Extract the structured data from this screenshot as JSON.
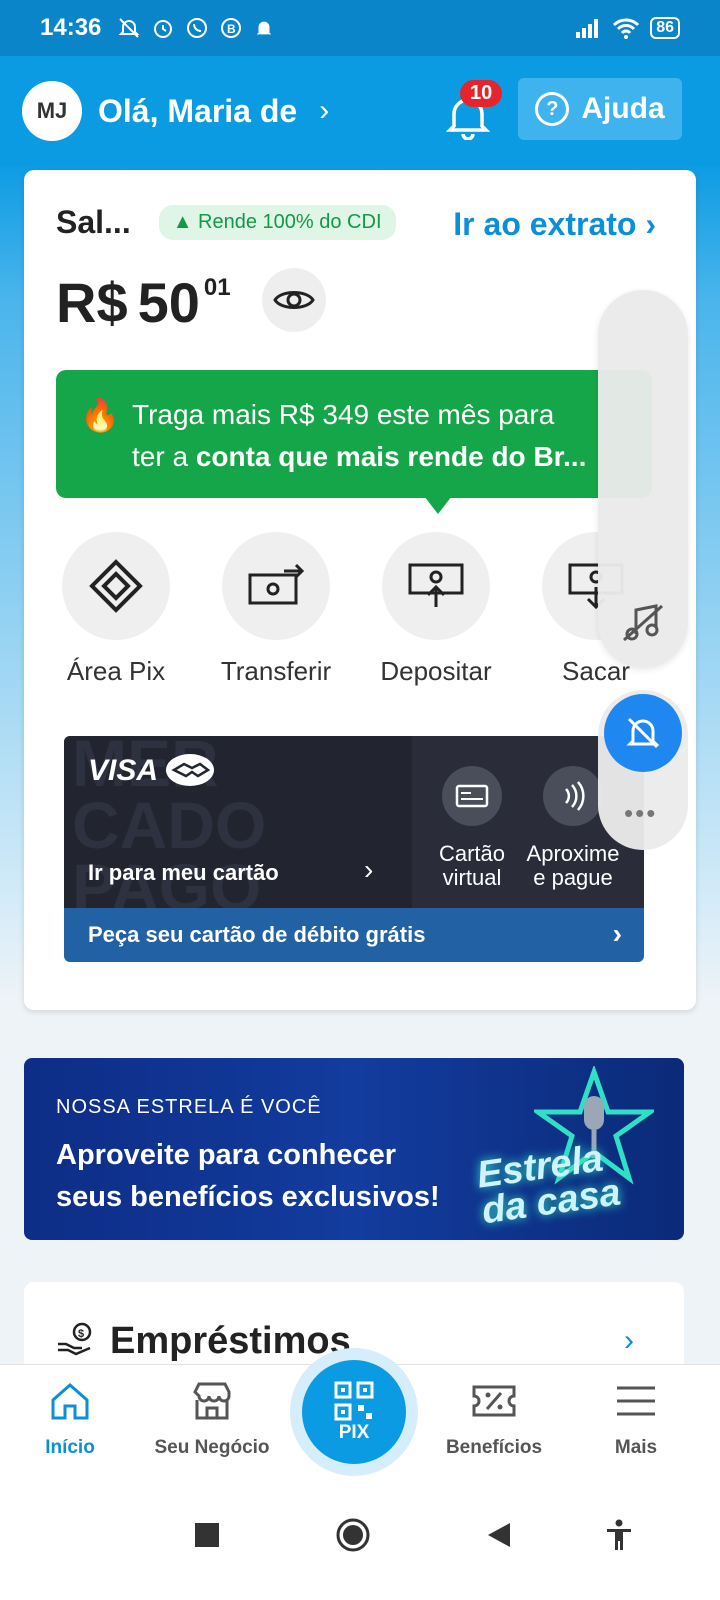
{
  "status_bar": {
    "time": "14:36",
    "battery": "86"
  },
  "header": {
    "avatar_initials": "MJ",
    "greeting": "Olá, Maria de",
    "notifications_count": "10",
    "help_label": "Ajuda"
  },
  "balance": {
    "label": "Sal...",
    "cdi_badge": "▲ Rende 100% do CDI",
    "statement_link": "Ir ao extrato",
    "currency": "R$",
    "amount_int": "50",
    "amount_cents": "01"
  },
  "promo": {
    "line1": "Traga mais R$ 349 este mês para",
    "line2_prefix": "ter a ",
    "line2_bold": "conta que mais rende do Br..."
  },
  "actions": [
    {
      "label": "Área Pix",
      "icon": "pix-icon"
    },
    {
      "label": "Transferir",
      "icon": "transfer-icon"
    },
    {
      "label": "Depositar",
      "icon": "deposit-icon"
    },
    {
      "label": "Sacar",
      "icon": "withdraw-icon"
    }
  ],
  "card": {
    "brand": "VISA",
    "watermark": "MER\nCADO\nPAGO",
    "go_to_card": "Ir para meu cartão",
    "virtual_line1": "Cartão",
    "virtual_line2": "virtual",
    "contactless_line1": "Aproxime",
    "contactless_line2": "e pague",
    "request_debit": "Peça seu cartão de débito grátis"
  },
  "banner": {
    "small": "NOSSA ESTRELA É VOCÊ",
    "line1": "Aproveite para conhecer",
    "line2": "seus benefícios exclusivos!",
    "logo_line1": "Estrela",
    "logo_line2": "da casa"
  },
  "loans": {
    "title": "Empréstimos"
  },
  "bottom_nav": [
    {
      "label": "Início",
      "active": true
    },
    {
      "label": "Seu Negócio",
      "active": false
    },
    {
      "label": "PIX",
      "active": false
    },
    {
      "label": "Benefícios",
      "active": false
    },
    {
      "label": "Mais",
      "active": false
    }
  ],
  "colors": {
    "brand_blue": "#0b9be3",
    "promo_green": "#16a64a",
    "badge_red": "#e5242b"
  }
}
